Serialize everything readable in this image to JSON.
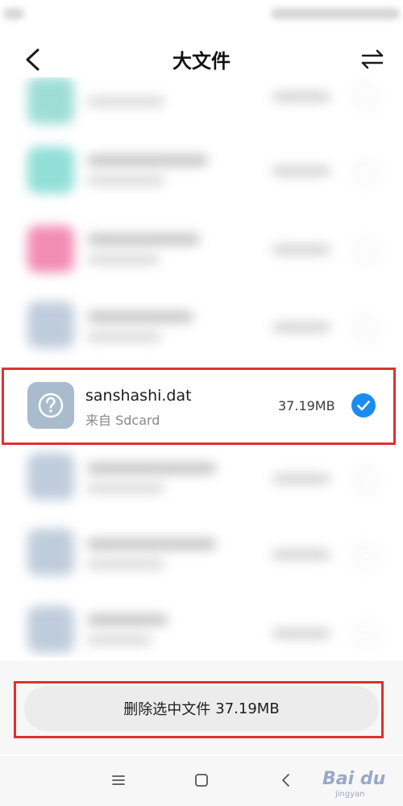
{
  "header": {
    "title": "大文件",
    "back_icon": "back-arrow-icon",
    "sort_icon": "sort-icon"
  },
  "selected_file": {
    "name": "sanshashi.dat",
    "source": "来自 Sdcard",
    "size": "37.19MB",
    "icon": "unknown-file-icon",
    "checked": true
  },
  "actions": {
    "delete_label": "删除选中文件",
    "delete_size": "37.19MB"
  },
  "nav": {
    "menu_icon": "menu-icon",
    "home_icon": "home-icon",
    "back_icon": "back-icon"
  },
  "watermark": {
    "text": "Bai du",
    "sub": "jingyan"
  },
  "colors": {
    "accent": "#1a8cf0",
    "highlight": "#e03030",
    "background": "#ffffff",
    "panel": "#f7f7f7"
  }
}
